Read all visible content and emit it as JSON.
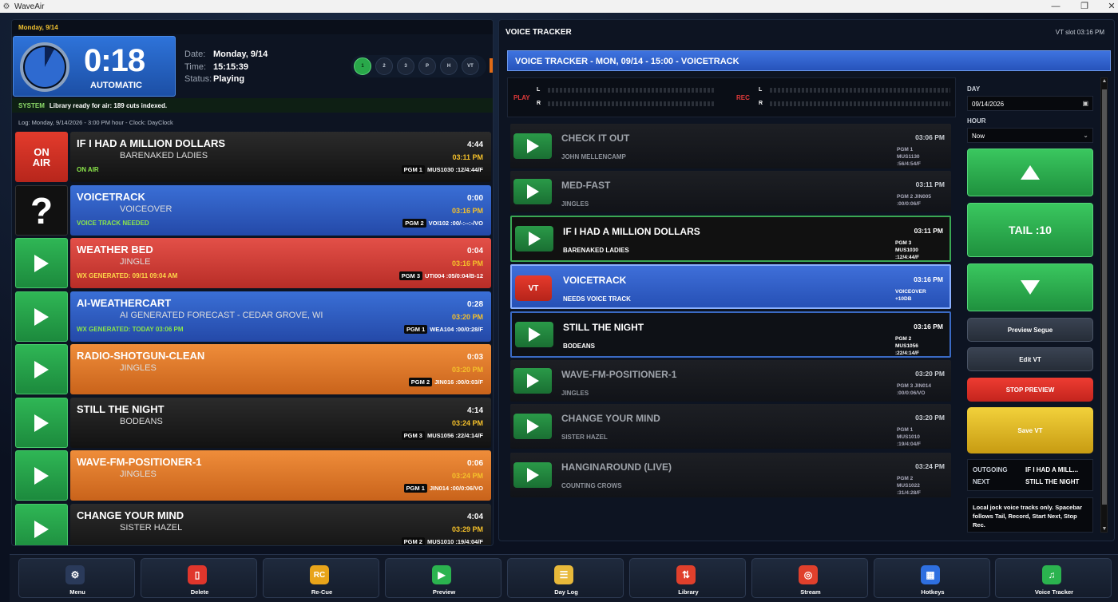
{
  "app": {
    "title": "WaveAir"
  },
  "left": {
    "date_header": "Monday, 9/14",
    "clock": {
      "time": "0:18",
      "mode": "AUTOMATIC"
    },
    "info": {
      "date_label": "Date:",
      "date_value": "Monday, 9/14",
      "time_label": "Time:",
      "time_value": "15:15:39",
      "status_label": "Status:",
      "status_value": "Playing"
    },
    "hour_buttons": [
      "1",
      "2",
      "3",
      "P",
      "H",
      "VT"
    ],
    "system": {
      "tag": "SYSTEM",
      "message": "Library ready for air: 189 cuts indexed."
    },
    "log_line": "Log: Monday, 9/14/2026 - 3:00 PM hour - Clock: DayClock",
    "carts": [
      {
        "title": "IF I HAD A MILLION DOLLARS",
        "artist": "BARENAKED LADIES",
        "status": "ON AIR",
        "duration": "4:44",
        "time": "03:11 PM",
        "pgm": "PGM 1",
        "code": "MUS1030 :12/4:44/F",
        "icon_text": "ON AIR"
      },
      {
        "title": "VOICETRACK",
        "artist": "VOICEOVER",
        "status": "VOICE TRACK NEEDED",
        "duration": "0:00",
        "time": "03:16 PM",
        "pgm": "PGM 2",
        "code": "VOI102 :00/-:--:-/VO",
        "icon_text": "?"
      },
      {
        "title": "WEATHER BED",
        "artist": "JINGLE",
        "status": "WX GENERATED: 09/11 09:04 AM",
        "duration": "0:04",
        "time": "03:16 PM",
        "pgm": "PGM 3",
        "code": "UTI004 :05/0:04/B-12"
      },
      {
        "title": "AI-WEATHERCART",
        "artist": "AI GENERATED FORECAST - CEDAR GROVE, WI",
        "status": "WX GENERATED: TODAY 03:06 PM",
        "duration": "0:28",
        "time": "03:20 PM",
        "pgm": "PGM 1",
        "code": "WEA104 :00/0:28/F"
      },
      {
        "title": "RADIO-SHOTGUN-CLEAN",
        "artist": "JINGLES",
        "status": "",
        "duration": "0:03",
        "time": "03:20 PM",
        "pgm": "PGM 2",
        "code": "JIN016 :00/0:03/F"
      },
      {
        "title": "STILL THE NIGHT",
        "artist": "BODEANS",
        "status": "",
        "duration": "4:14",
        "time": "03:24 PM",
        "pgm": "PGM 3",
        "code": "MUS1056 :22/4:14/F"
      },
      {
        "title": "WAVE-FM-POSITIONER-1",
        "artist": "JINGLES",
        "status": "",
        "duration": "0:06",
        "time": "03:24 PM",
        "pgm": "PGM 1",
        "code": "JIN014 :00/0:06/VO"
      },
      {
        "title": "CHANGE YOUR MIND",
        "artist": "SISTER HAZEL",
        "status": "",
        "duration": "4:04",
        "time": "03:29 PM",
        "pgm": "PGM 2",
        "code": "MUS1010 :19/4:04/F"
      }
    ]
  },
  "right": {
    "header": "VOICE TRACKER",
    "slot": "VT slot 03:16 PM",
    "banner": "VOICE TRACKER - MON, 09/14 - 15:00 - VOICETRACK",
    "meters": {
      "play": "PLAY",
      "rec": "REC",
      "l": "L",
      "r": "R"
    },
    "tracks": [
      {
        "title": "CHECK IT OUT",
        "sub": "JOHN MELLENCAMP",
        "time": "03:06 PM",
        "code": [
          "PGM 1",
          "MUS1130",
          ":56/4:54/F"
        ]
      },
      {
        "title": "MED-FAST",
        "sub": "JINGLES",
        "time": "03:11 PM",
        "code": [
          "PGM 2 JIN005",
          ":00/0:06/F"
        ]
      },
      {
        "title": "IF I HAD A MILLION DOLLARS",
        "sub": "BARENAKED LADIES",
        "time": "03:11 PM",
        "code": [
          "PGM 3",
          "MUS1030",
          ":12/4:44/F"
        ]
      },
      {
        "title": "VOICETRACK",
        "sub": "NEEDS VOICE TRACK",
        "time": "03:16 PM",
        "code": [
          "VOICEOVER",
          "+10DB"
        ],
        "btn": "VT"
      },
      {
        "title": "STILL THE NIGHT",
        "sub": "BODEANS",
        "time": "03:16 PM",
        "code": [
          "PGM 2",
          "MUS1056",
          ":22/4:14/F"
        ]
      },
      {
        "title": "WAVE-FM-POSITIONER-1",
        "sub": "JINGLES",
        "time": "03:20 PM",
        "code": [
          "PGM 3 JIN014",
          ":00/0:06/VO"
        ]
      },
      {
        "title": "CHANGE YOUR MIND",
        "sub": "SISTER HAZEL",
        "time": "03:20 PM",
        "code": [
          "PGM 1",
          "MUS1010",
          ":19/4:04/F"
        ]
      },
      {
        "title": "HANGINAROUND (LIVE)",
        "sub": "COUNTING CROWS",
        "time": "03:24 PM",
        "code": [
          "PGM 2",
          "MUS1022",
          ":31/4:28/F"
        ]
      }
    ],
    "side": {
      "day_label": "DAY",
      "day_value": "09/14/2026",
      "hour_label": "HOUR",
      "hour_value": "Now",
      "tail_label": "TAIL :10",
      "preview_segue": "Preview Segue",
      "edit_vt": "Edit VT",
      "stop_preview": "STOP PREVIEW",
      "save_vt": "Save VT",
      "outgoing_label": "OUTGOING",
      "outgoing_value": "IF I HAD A MILL...",
      "next_label": "NEXT",
      "next_value": "STILL THE NIGHT",
      "note": "Local jock voice tracks only. Spacebar follows Tail, Record, Start Next, Stop Rec."
    }
  },
  "toolbar": [
    {
      "label": "Menu",
      "icon": "gear-icon",
      "color": "#2a3a5a"
    },
    {
      "label": "Delete",
      "icon": "trash-icon",
      "color": "#e0362c"
    },
    {
      "label": "Re-Cue",
      "icon": "recue-icon",
      "color": "#e8a41a",
      "glyph": "RC"
    },
    {
      "label": "Preview",
      "icon": "play-icon",
      "color": "#2bb34f"
    },
    {
      "label": "Day Log",
      "icon": "log-icon",
      "color": "#e8b93a"
    },
    {
      "label": "Library",
      "icon": "sort-icon",
      "color": "#e0402c"
    },
    {
      "label": "Stream",
      "icon": "stream-icon",
      "color": "#e0402c"
    },
    {
      "label": "Hotkeys",
      "icon": "grid-icon",
      "color": "#2e6fe0"
    },
    {
      "label": "Voice Tracker",
      "icon": "music-icon",
      "color": "#2bb34f"
    }
  ]
}
